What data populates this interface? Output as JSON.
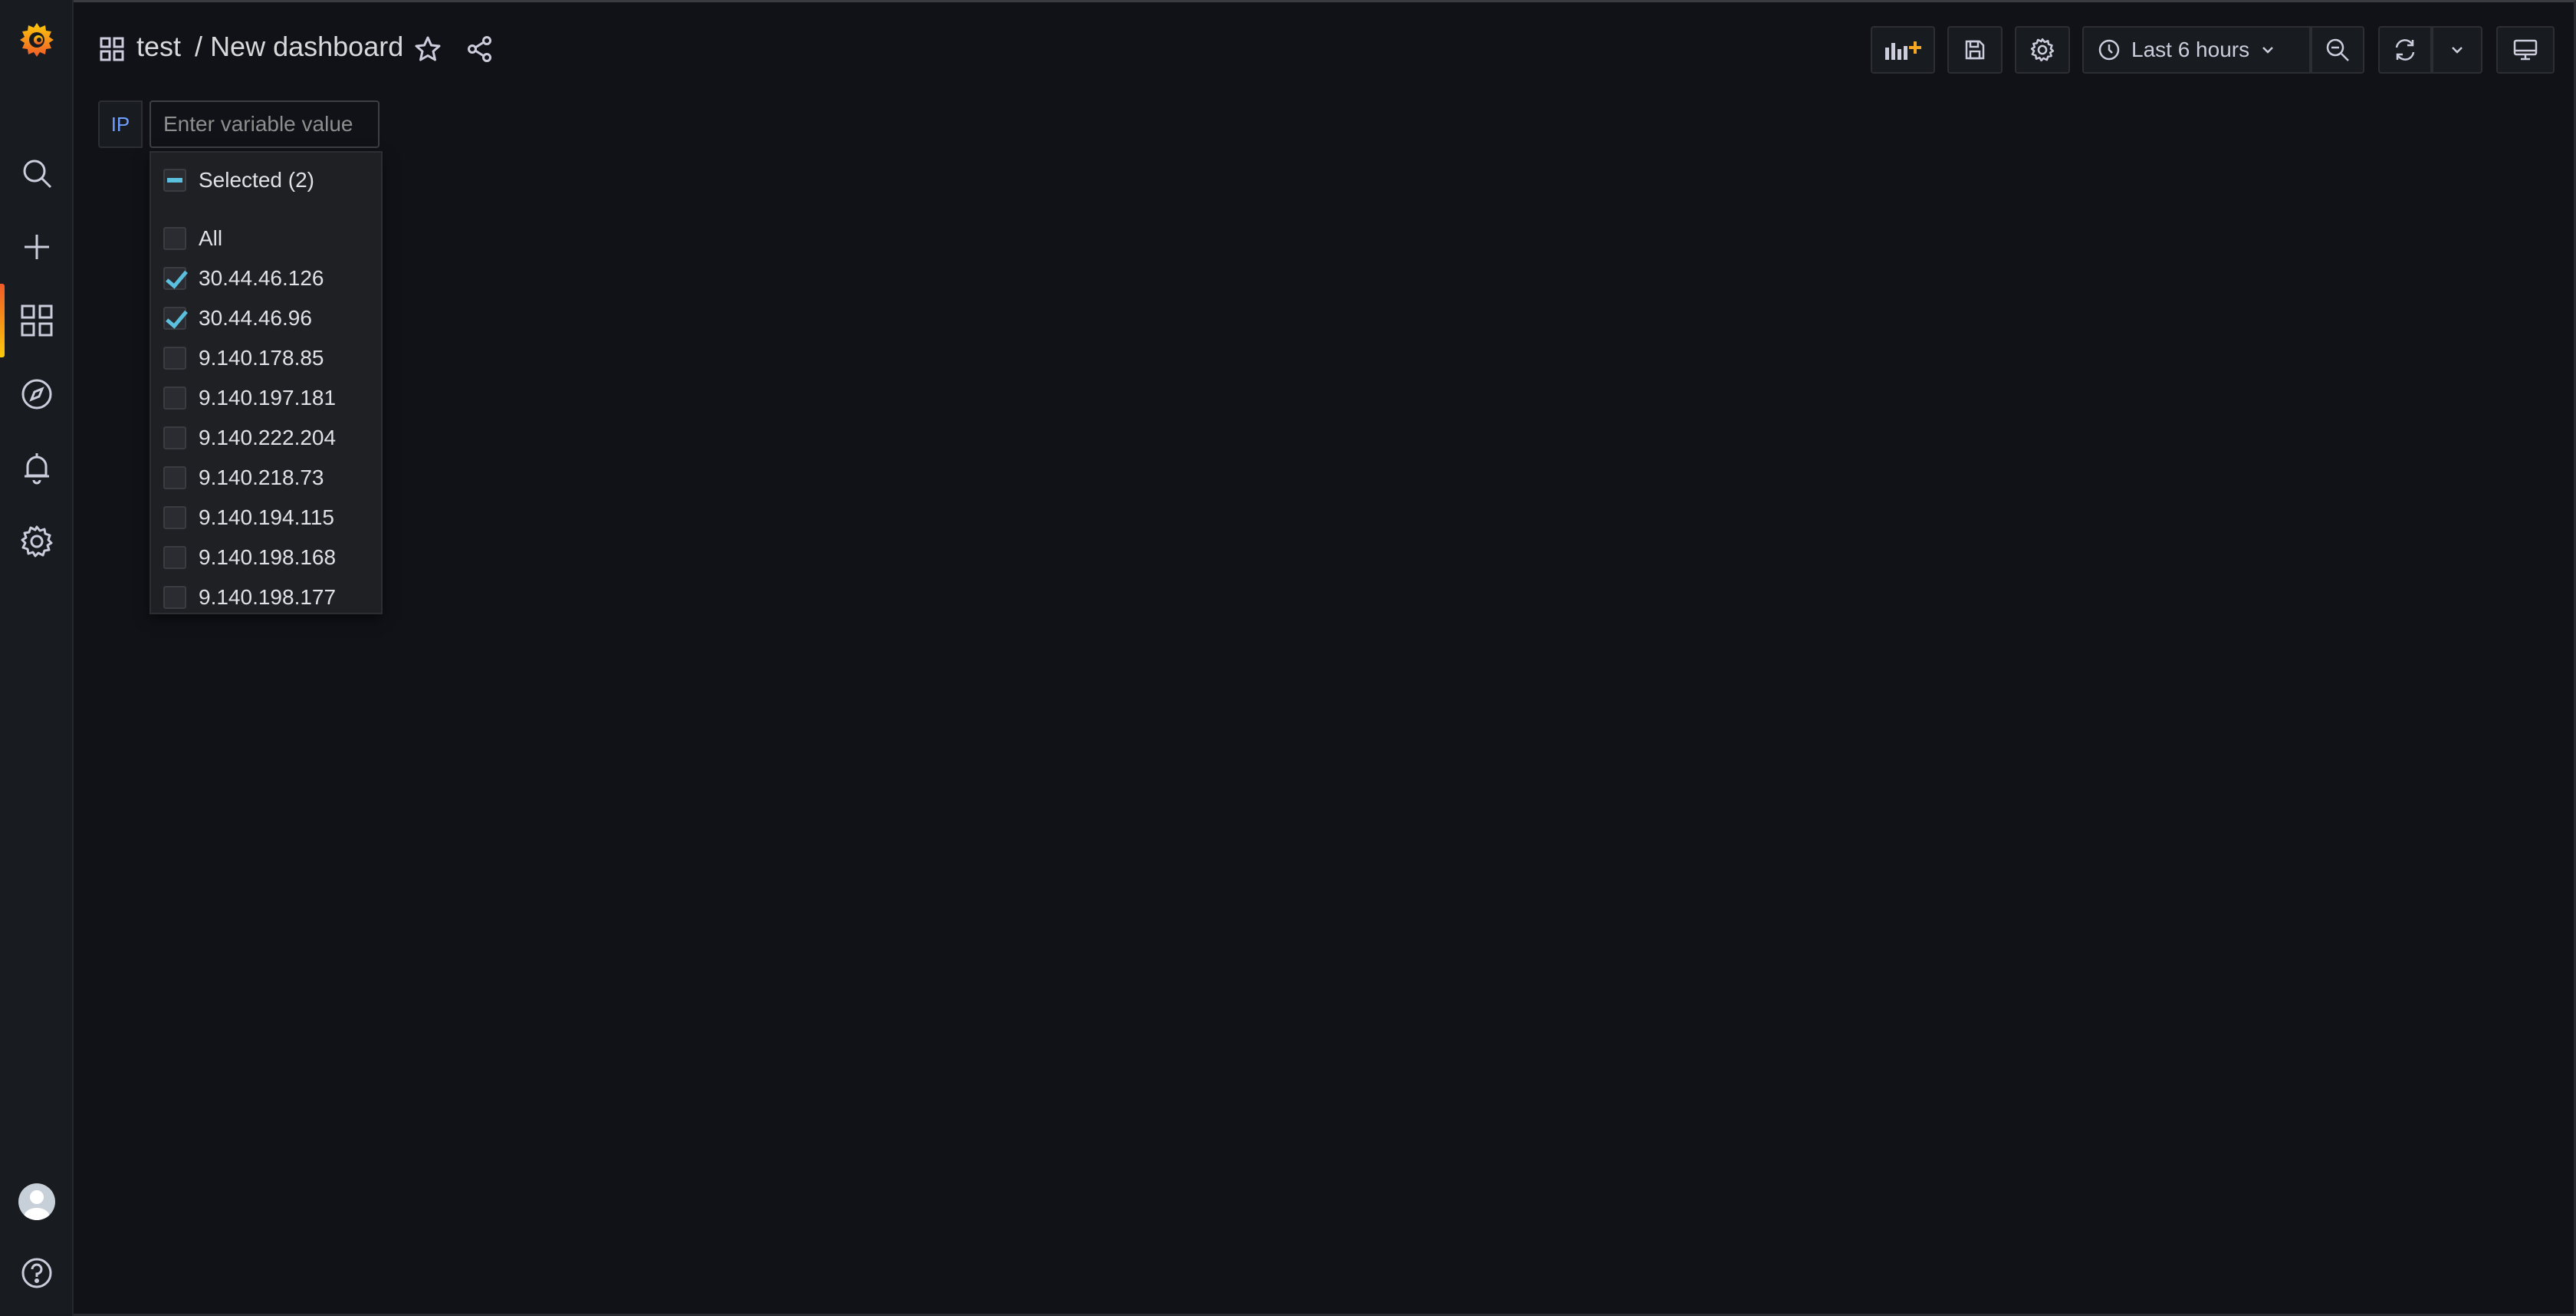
{
  "breadcrumb": {
    "folder": "test",
    "separator": "/",
    "dashboard": "New dashboard"
  },
  "toolbar": {
    "time_range": "Last 6 hours"
  },
  "variable": {
    "label": "IP",
    "placeholder": "Enter variable value",
    "selected_label": "Selected (2)",
    "options": [
      {
        "label": "All",
        "checked": false
      },
      {
        "label": "30.44.46.126",
        "checked": true
      },
      {
        "label": "30.44.46.96",
        "checked": true
      },
      {
        "label": "9.140.178.85",
        "checked": false
      },
      {
        "label": "9.140.197.181",
        "checked": false
      },
      {
        "label": "9.140.222.204",
        "checked": false
      },
      {
        "label": "9.140.218.73",
        "checked": false
      },
      {
        "label": "9.140.194.115",
        "checked": false
      },
      {
        "label": "9.140.198.168",
        "checked": false
      },
      {
        "label": "9.140.198.177",
        "checked": false
      }
    ]
  },
  "colors": {
    "background": "#111217",
    "sidebar": "#181b1f",
    "accent_orange": "#f05a28",
    "checkbox_check": "#5bc0de",
    "variable_label": "#6e9fff"
  },
  "sidebar_icons": [
    "grafana-logo-icon",
    "search-icon",
    "plus-icon",
    "dashboards-icon",
    "explore-icon",
    "alert-bell-icon",
    "gear-icon",
    "avatar",
    "help-icon"
  ]
}
